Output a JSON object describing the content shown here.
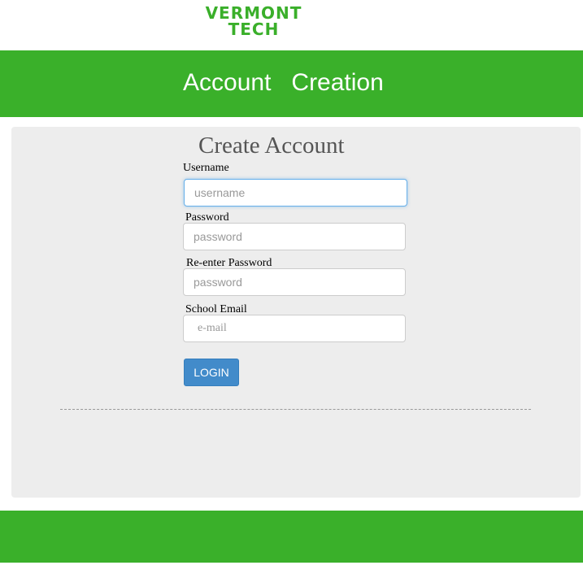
{
  "logo": {
    "line1": "VERMONT",
    "line2": "TECH"
  },
  "header": {
    "title": "Account   Creation"
  },
  "form": {
    "title": "Create Account",
    "username_label": "Username",
    "username_placeholder": "username",
    "password_label": "Password",
    "password_placeholder": "password",
    "reenter_label": "Re-enter Password",
    "reenter_placeholder": "password",
    "email_label": "School Email",
    "email_placeholder": "e-mail",
    "login_label": "LOGIN"
  },
  "colors": {
    "brand_green": "#3ab02a",
    "panel_bg": "#ededed",
    "button_blue": "#428bca"
  }
}
